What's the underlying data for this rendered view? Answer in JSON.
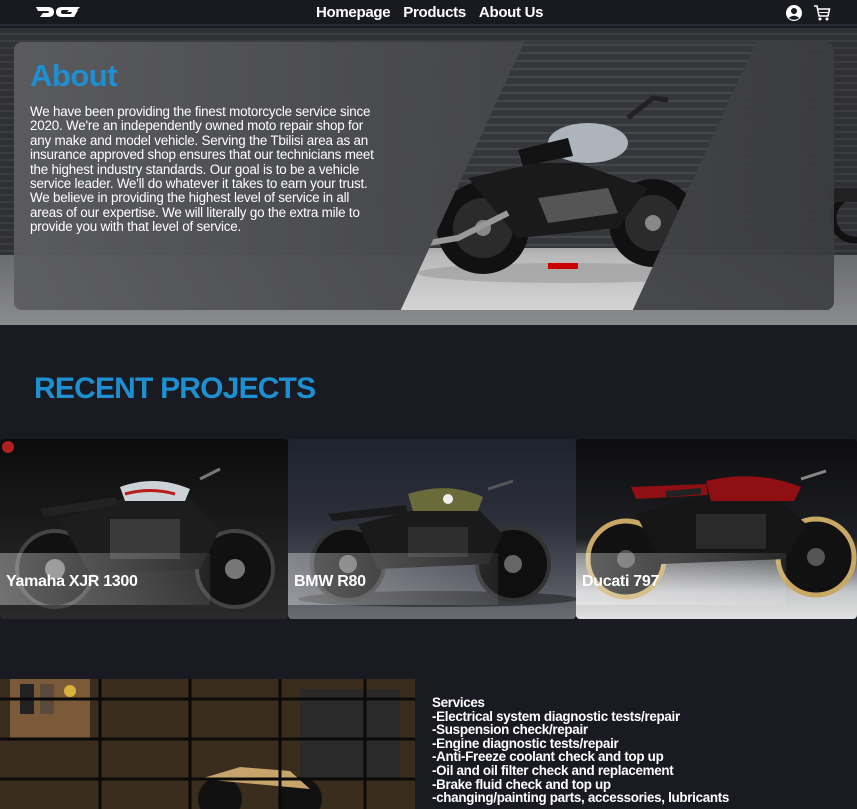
{
  "nav": {
    "logo": "logo-icon",
    "links": [
      "Homepage",
      "Products",
      "About Us"
    ],
    "icons": [
      "user-icon",
      "cart-icon"
    ]
  },
  "about": {
    "title": "About",
    "text": "We have been providing the finest motorcycle service since 2020. We're an independently owned moto repair shop for any make and model vehicle. Serving the Tbilisi area as an insurance approved shop ensures that our technicians meet the highest industry standards. Our goal is to be a vehicle service leader. We'll do whatever it takes to earn your trust. We believe in providing the highest level of service in all areas of our expertise. We will literally go the extra mile to provide you with that level of service."
  },
  "projects": {
    "title": "RECENT PROJECTS",
    "items": [
      {
        "label": "Yamaha XJR 1300",
        "accent": "#c9cdd3"
      },
      {
        "label": "BMW R80",
        "accent": "#6a6a3a"
      },
      {
        "label": "Ducati 797",
        "accent": "#8f0f12"
      }
    ]
  },
  "services": {
    "heading": "Services",
    "items": [
      "-Electrical system diagnostic tests/repair",
      "-Suspension check/repair",
      "-Engine diagnostic tests/repair",
      "-Anti-Freeze coolant check and top up",
      "-Oil and oil filter check and replacement",
      "-Brake fluid check and top up",
      "-changing/painting parts, accessories, lubricants"
    ]
  },
  "colors": {
    "accent": "#1e8fd0",
    "background": "#1a1b22"
  }
}
